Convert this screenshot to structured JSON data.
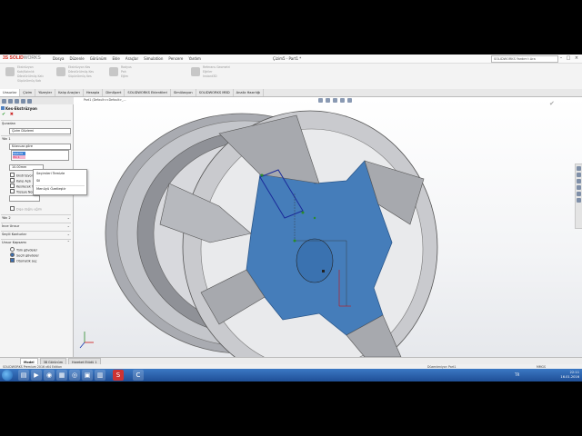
{
  "app": {
    "logo_main": "3S SOLID",
    "logo_rest": "WORKS",
    "menu": [
      "Dosya",
      "Düzenle",
      "Görünüm",
      "Ekle",
      "Araçlar",
      "Simulation",
      "Pencere",
      "Yardım"
    ],
    "document_title": "Çizim5 - Part1 *",
    "search_placeholder": "SOLIDWORKS Yardım'ı Ara"
  },
  "ribbon_groups": [
    [
      "Ekstrüzyon Katı/Kalınlık",
      "Döndürülmüş Katı",
      "Süpürülmüş Katı"
    ],
    [
      "Ekstrüzyon Kes",
      "Döndürülmüş Kes",
      "Süpürülmüş Kes"
    ],
    [
      "Radyus",
      "Pah",
      "Eğim"
    ],
    [
      "Referans Geometri",
      "Eğriler",
      "Instant3D"
    ]
  ],
  "tabs": [
    "Unsurlar",
    "Çizim",
    "Yüzeyler",
    "Kalıp Araçları",
    "Hesapla",
    "DimXpert",
    "SOLIDWORKS Eklentileri",
    "Simülasyon",
    "SOLIDWORKS MBD",
    "Analiz Hazırlığı"
  ],
  "viewport": {
    "tree_label": "Part1 (Default<<Default>_...",
    "confirm_glyph": "✔"
  },
  "panel": {
    "title": "Kes-Ekstrüzyon",
    "ok": "✔",
    "cancel": "✖",
    "from_label": "Şuradan",
    "from_value": "Çizim Düzlemi",
    "dir1_label": "Yön 1",
    "dir1_value": "Kılavuza göre",
    "sel_item1": "Sketch5",
    "sel_item2": "Yön 1",
    "depth_value": "10.00mm",
    "options": [
      "Ekstrüzyon Yönü Çevir",
      "Kalıp Açılı",
      "Kesilecek Tarafı Çevir",
      "Yüzeye Normal"
    ],
    "draft_label": "Dışa doğru eğim",
    "dir2_label": "Yön 2",
    "thin_label": "İnce Unsur",
    "selected_contours": "Seçili Konturlar",
    "feature_scope": "Unsur Kapsamı",
    "scope_options": [
      "Tüm gövdeler",
      "Seçili gövdeler",
      "Otomatik seç"
    ]
  },
  "context_menu": [
    "Seçimleri Temizle",
    "Sil",
    "Menüyü Özelleştir"
  ],
  "bottom_tabs": [
    "Model",
    "3B Görünüm",
    "Hareket Etüdü 1"
  ],
  "status": {
    "left": "SOLIDWORKS Premium 2016 x64 Edition",
    "mode": "Düzenleniyor: Part1",
    "units": "MMGS"
  },
  "taskbar": {
    "lang": "TR",
    "time": "22:11",
    "date": "16.01.2016"
  },
  "colors": {
    "accent_blue": "#3f82d6",
    "face_blue": "#3d78b8",
    "rim_gray": "#b4b6bc",
    "taskbar_blue": "#2a62b0"
  }
}
